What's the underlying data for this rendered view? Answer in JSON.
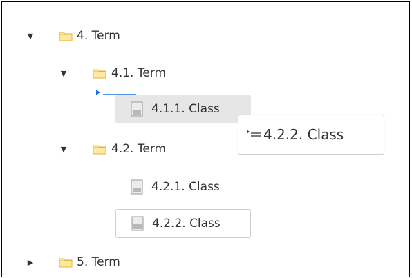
{
  "tree": {
    "nodes": [
      {
        "id": "term-4",
        "label": "4. Term",
        "expanded": true,
        "icon": "folder-icon"
      },
      {
        "id": "term-4-1",
        "label": "4.1. Term",
        "expanded": true,
        "icon": "folder-icon"
      },
      {
        "id": "class-4-1-1",
        "label": "4.1.1. Class",
        "icon": "document-icon",
        "state": "selected"
      },
      {
        "id": "term-4-2",
        "label": "4.2. Term",
        "expanded": true,
        "icon": "folder-icon"
      },
      {
        "id": "class-4-2-1",
        "label": "4.2.1. Class",
        "icon": "document-icon"
      },
      {
        "id": "class-4-2-2",
        "label": "4.2.2. Class",
        "icon": "document-icon",
        "state": "dragged-source"
      },
      {
        "id": "term-5",
        "label": "5. Term",
        "expanded": false,
        "icon": "folder-icon"
      }
    ]
  },
  "drag_tooltip": {
    "label": "4.2.2. Class",
    "icon": "drag-node-icon"
  },
  "colors": {
    "folder_fill": "#fde9a0",
    "folder_stroke": "#e3b53c",
    "drop_indicator": "#1a73e8",
    "selected_bg": "#e6e6e6",
    "text": "#333333"
  }
}
